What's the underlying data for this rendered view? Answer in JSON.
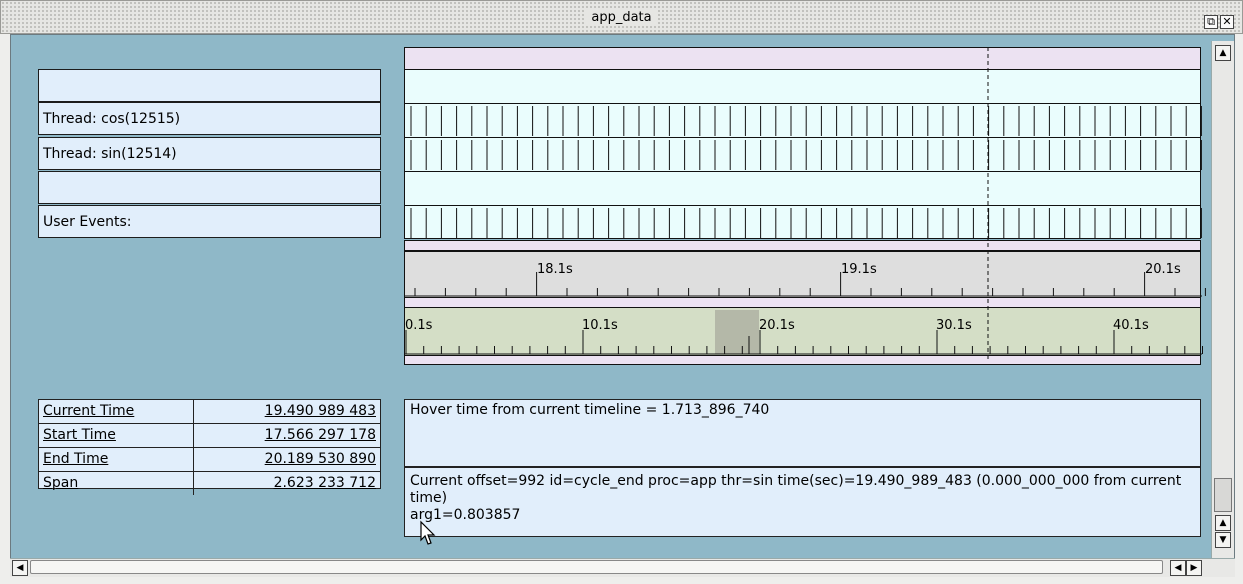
{
  "window": {
    "title": "app_data"
  },
  "rows": [
    {
      "label": ""
    },
    {
      "label": "Thread: cos(12515)"
    },
    {
      "label": "Thread: sin(12514)"
    },
    {
      "label": ""
    },
    {
      "label": "User Events:"
    }
  ],
  "ruler_zoom": {
    "ticks": [
      "18.1s",
      "19.1s",
      "20.1s"
    ]
  },
  "ruler_full": {
    "ticks": [
      "0.1s",
      "10.1s",
      "20.1s",
      "30.1s",
      "40.1s"
    ]
  },
  "stats": [
    {
      "label": "Current Time",
      "value": "19.490 989 483"
    },
    {
      "label": "Start Time",
      "value": "17.566 297 178"
    },
    {
      "label": "End Time",
      "value": "20.189 530 890"
    },
    {
      "label": "Span",
      "value": "2.623 233 712"
    }
  ],
  "hover_text": "Hover time from current timeline = 1.713_896_740",
  "event_text": "Current offset=992  id=cycle_end  proc=app  thr=sin  time(sec)=19.490_989_483   (0.000_000_000 from current time)",
  "arg_text": "arg1=0.803857",
  "colors": {
    "frame": "#8fb8c8",
    "track": "#eafdfd",
    "panel": "#e1eefb",
    "lavender": "#ece2f2",
    "ruler_zoom": "#dedede",
    "ruler_full": "#d4dec6"
  }
}
